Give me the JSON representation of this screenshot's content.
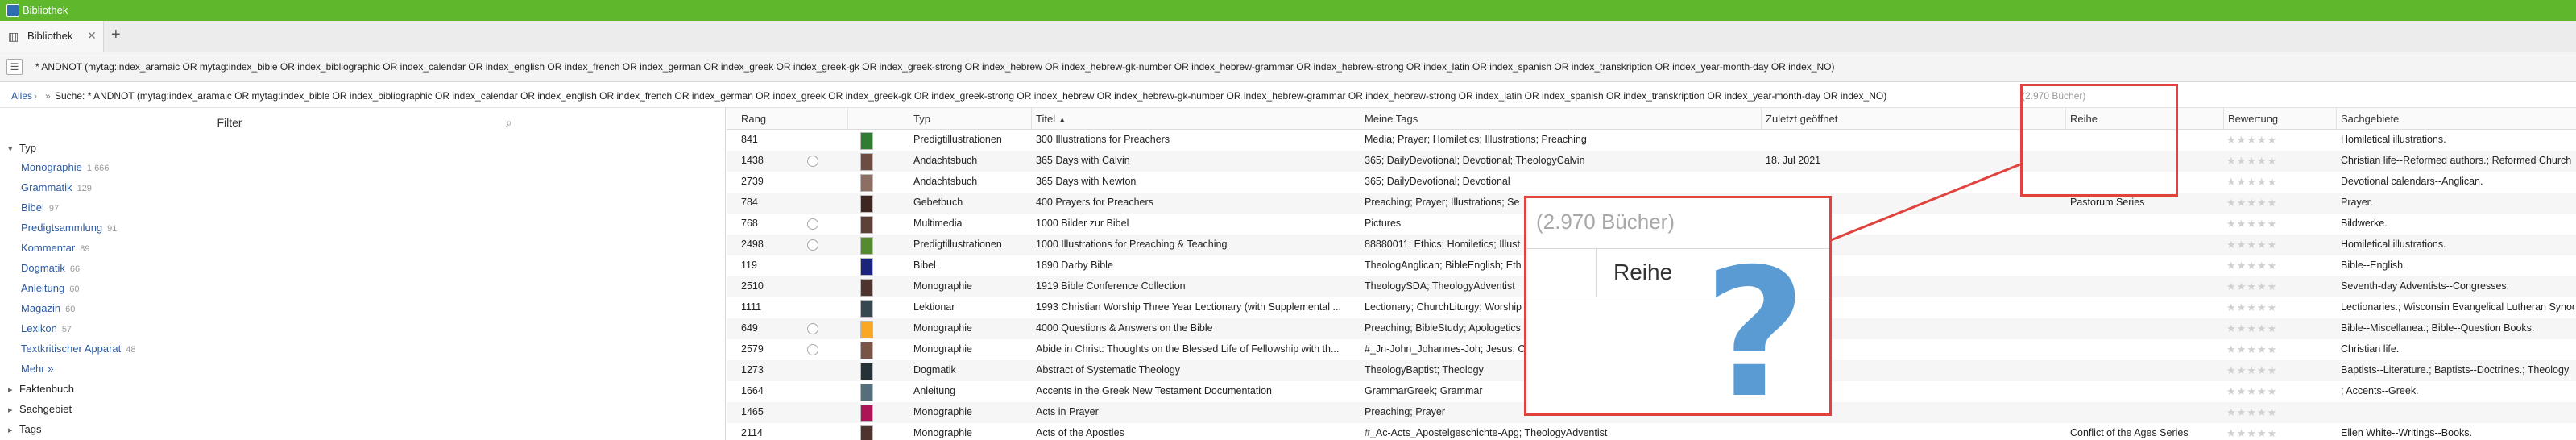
{
  "window": {
    "title": "Bibliothek"
  },
  "tabs": {
    "active_label": "Bibliothek",
    "close_glyph": "✕",
    "add_glyph": "+"
  },
  "search": {
    "query": "* ANDNOT (mytag:index_aramaic OR mytag:index_bible OR index_bibliographic OR index_calendar OR index_english OR index_french OR index_german OR index_greek OR index_greek-gk OR index_greek-strong OR index_hebrew OR index_hebrew-gk-number OR index_hebrew-grammar OR index_hebrew-strong OR index_latin OR index_spanish OR index_transkription OR index_year-month-day OR index_NO)"
  },
  "breadcrumb": {
    "all": "Alles",
    "text": "Suche: * ANDNOT (mytag:index_aramaic OR mytag:index_bible OR index_bibliographic OR index_calendar OR index_english OR index_french OR index_german OR index_greek OR index_greek-gk OR index_greek-strong OR index_hebrew OR index_hebrew-gk-number OR index_hebrew-grammar OR index_hebrew-strong OR index_latin OR index_spanish OR index_transkription OR index_year-month-day OR index_NO)",
    "count": "(2.970 Bücher)"
  },
  "sidebar": {
    "title": "Filter",
    "group_typ": "Typ",
    "items": [
      {
        "label": "Monographie",
        "count": "1,666"
      },
      {
        "label": "Grammatik",
        "count": "129"
      },
      {
        "label": "Bibel",
        "count": "97"
      },
      {
        "label": "Predigtsammlung",
        "count": "91"
      },
      {
        "label": "Kommentar",
        "count": "89"
      },
      {
        "label": "Dogmatik",
        "count": "66"
      },
      {
        "label": "Anleitung",
        "count": "60"
      },
      {
        "label": "Magazin",
        "count": "60"
      },
      {
        "label": "Lexikon",
        "count": "57"
      },
      {
        "label": "Textkritischer Apparat",
        "count": "48"
      }
    ],
    "more": "Mehr »",
    "groups": [
      "Faktenbuch",
      "Sachgebiet",
      "Tags"
    ]
  },
  "table": {
    "columns": {
      "rang": "Rang",
      "typ": "Typ",
      "titel": "Titel",
      "tags": "Meine Tags",
      "opened": "Zuletzt geöffnet",
      "reihe": "Reihe",
      "bewertung": "Bewertung",
      "sachgebiete": "Sachgebiete"
    },
    "rows": [
      {
        "rang": "841",
        "typ": "Predigtillustrationen",
        "titel": "300 Illustrations for Preachers",
        "tags": "Media; Prayer; Homiletics; Illustrations; Preaching",
        "opened": "",
        "reihe": "",
        "sach": "Homiletical illustrations.",
        "radio": false,
        "cover": "#2e7d32"
      },
      {
        "rang": "1438",
        "typ": "Andachtsbuch",
        "titel": "365 Days with Calvin",
        "tags": "365; DailyDevotional; Devotional; TheologyCalvin",
        "opened": "18. Jul 2021",
        "reihe": "",
        "sach": "Christian life--Reformed authors.; Reformed Church",
        "radio": true,
        "cover": "#6d4c41"
      },
      {
        "rang": "2739",
        "typ": "Andachtsbuch",
        "titel": "365 Days with Newton",
        "tags": "365; DailyDevotional; Devotional",
        "opened": "",
        "reihe": "",
        "sach": "Devotional calendars--Anglican.",
        "radio": false,
        "cover": "#8d6e63"
      },
      {
        "rang": "784",
        "typ": "Gebetbuch",
        "titel": "400 Prayers for Preachers",
        "tags": "Preaching; Prayer; Illustrations; Se",
        "opened": "",
        "reihe": "Pastorum Series",
        "sach": "Prayer.",
        "radio": false,
        "cover": "#3e2723"
      },
      {
        "rang": "768",
        "typ": "Multimedia",
        "titel": "1000 Bilder zur Bibel",
        "tags": "Pictures",
        "opened": "",
        "reihe": "",
        "sach": "Bildwerke.",
        "radio": true,
        "cover": "#5d4037"
      },
      {
        "rang": "2498",
        "typ": "Predigtillustrationen",
        "titel": "1000 Illustrations for Preaching & Teaching",
        "tags": "88880011; Ethics; Homiletics; Illust",
        "opened": "",
        "reihe": "",
        "sach": "Homiletical illustrations.",
        "radio": true,
        "cover": "#558b2f"
      },
      {
        "rang": "119",
        "typ": "Bibel",
        "titel": "1890 Darby Bible",
        "tags": "TheologAnglican; BibleEnglish; Eth",
        "opened": "",
        "reihe": "",
        "sach": "Bible--English.",
        "radio": false,
        "cover": "#1a237e"
      },
      {
        "rang": "2510",
        "typ": "Monographie",
        "titel": "1919 Bible Conference Collection",
        "tags": "TheologySDA; TheologyAdventist",
        "opened": "",
        "reihe": "",
        "sach": "Seventh-day Adventists--Congresses.",
        "radio": false,
        "cover": "#4e342e"
      },
      {
        "rang": "1111",
        "typ": "Lektionar",
        "titel": "1993 Christian Worship Three Year Lectionary (with Supplemental ...",
        "tags": "Lectionary; ChurchLiturgy; Worship",
        "opened": "",
        "reihe": "",
        "sach": "Lectionaries.; Wisconsin Evangelical Lutheran Synod",
        "radio": false,
        "cover": "#37474f"
      },
      {
        "rang": "649",
        "typ": "Monographie",
        "titel": "4000 Questions & Answers on the Bible",
        "tags": "Preaching; BibleStudy; Apologetics",
        "opened": "",
        "reihe": "",
        "sach": "Bible--Miscellanea.; Bible--Question Books.",
        "radio": true,
        "cover": "#f9a825"
      },
      {
        "rang": "2579",
        "typ": "Monographie",
        "titel": "Abide in Christ: Thoughts on the Blessed Life of Fellowship with th...",
        "tags": "#_Jn-John_Johannes-Joh; Jesus; C",
        "opened": "",
        "reihe": "",
        "sach": "Christian life.",
        "radio": true,
        "cover": "#795548"
      },
      {
        "rang": "1273",
        "typ": "Dogmatik",
        "titel": "Abstract of Systematic Theology",
        "tags": "TheologyBaptist; Theology",
        "opened": "",
        "reihe": "",
        "sach": "Baptists--Literature.; Baptists--Doctrines.; Theology",
        "radio": false,
        "cover": "#263238"
      },
      {
        "rang": "1664",
        "typ": "Anleitung",
        "titel": "Accents in the Greek New Testament Documentation",
        "tags": "GrammarGreek; Grammar",
        "opened": "",
        "reihe": "",
        "sach": "; Accents--Greek.",
        "radio": false,
        "cover": "#546e7a"
      },
      {
        "rang": "1465",
        "typ": "Monographie",
        "titel": "Acts in Prayer",
        "tags": "Preaching; Prayer",
        "opened": "",
        "reihe": "",
        "sach": "",
        "radio": false,
        "cover": "#ad1457"
      },
      {
        "rang": "2114",
        "typ": "Monographie",
        "titel": "Acts of the Apostles",
        "tags": "#_Ac-Acts_Apostelgeschichte-Apg; TheologyAdventist",
        "opened": "",
        "reihe": "Conflict of the Ages Series",
        "sach": "Ellen White--Writings--Books.",
        "radio": false,
        "cover": "#4e342e"
      }
    ],
    "rating_glyphs": "★★★★★"
  },
  "zoom": {
    "count": "(2.970 Bücher)",
    "column": "Reihe",
    "symbol": "?"
  },
  "colors": {
    "titlebar": "#5fb82c",
    "link": "#2b5aa6",
    "highlight": "#e0433d",
    "question": "#5a9bd4"
  }
}
